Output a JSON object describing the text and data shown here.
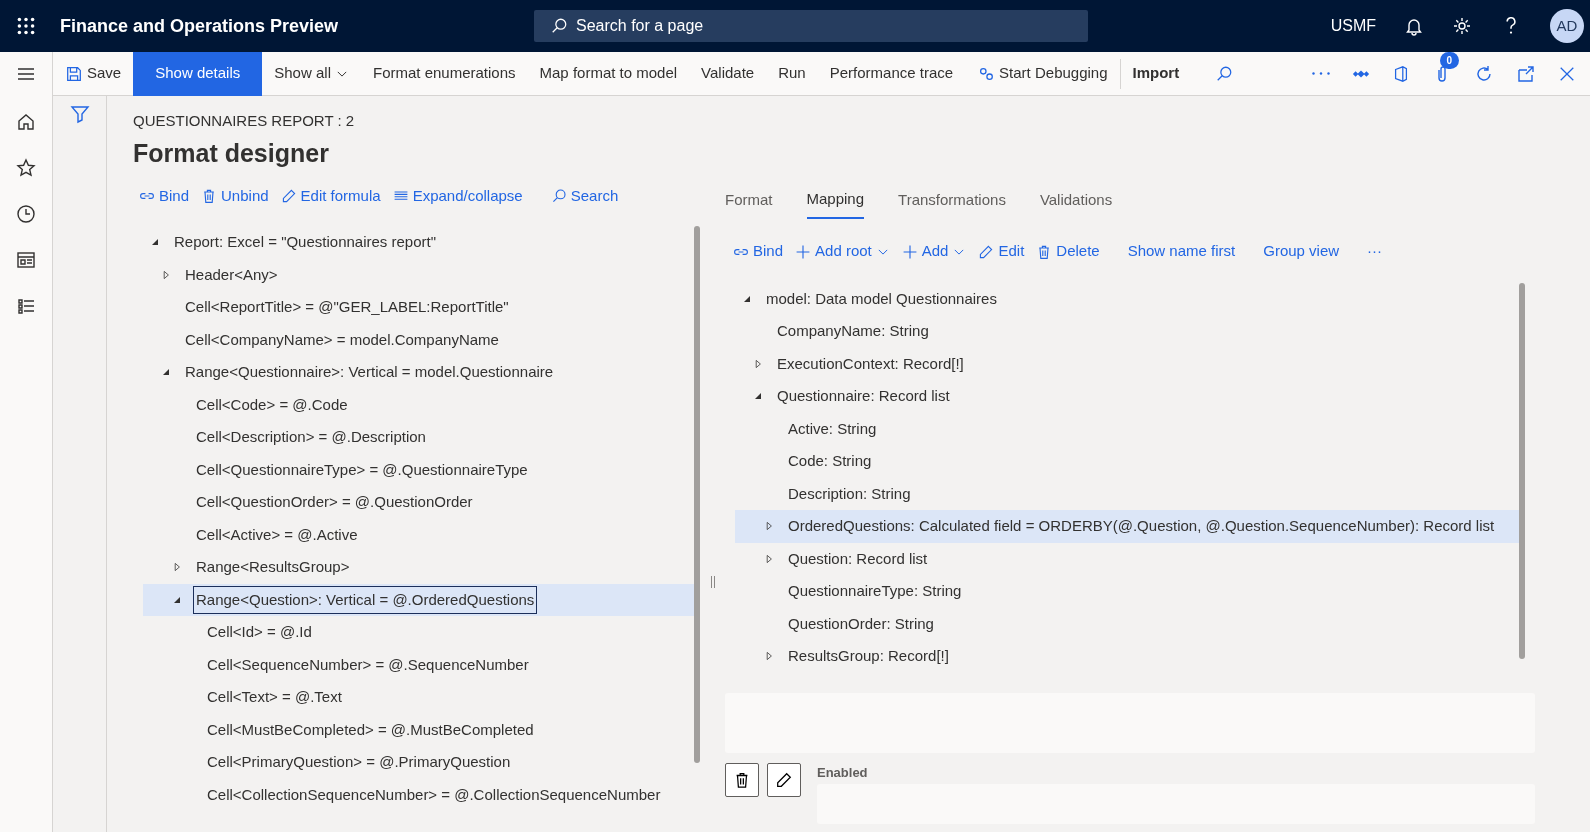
{
  "header": {
    "app_title": "Finance and Operations Preview",
    "search_placeholder": "Search for a page",
    "company": "USMF",
    "avatar": "AD"
  },
  "action_bar": {
    "items": [
      {
        "label": "Save",
        "kind": "save"
      },
      {
        "label": "Show details",
        "kind": "primary"
      },
      {
        "label": "Show all",
        "kind": "menu"
      },
      {
        "label": "Format enumerations",
        "kind": "plain"
      },
      {
        "label": "Map format to model",
        "kind": "plain"
      },
      {
        "label": "Validate",
        "kind": "plain"
      },
      {
        "label": "Run",
        "kind": "plain"
      },
      {
        "label": "Performance trace",
        "kind": "plain"
      },
      {
        "label": "Start Debugging",
        "kind": "debug"
      },
      {
        "label": "Import",
        "kind": "bold"
      }
    ],
    "attachments_count": "0"
  },
  "page": {
    "breadcrumb": "QUESTIONNAIRES REPORT : 2",
    "title": "Format designer"
  },
  "format_toolbar": [
    "Bind",
    "Unbind",
    "Edit formula",
    "Expand/collapse",
    "Search"
  ],
  "format_tree": [
    {
      "label": "Report: Excel = \"Questionnaires report\"",
      "expanded": true,
      "selected": false,
      "children": [
        {
          "label": "Header<Any>",
          "expanded": false,
          "selected": false
        },
        {
          "label": "Cell<ReportTitle> = @\"GER_LABEL:ReportTitle\"",
          "selected": false
        },
        {
          "label": "Cell<CompanyName> = model.CompanyName",
          "selected": false
        },
        {
          "label": "Range<Questionnaire>: Vertical = model.Questionnaire",
          "expanded": true,
          "selected": false,
          "children": [
            {
              "label": "Cell<Code> = @.Code",
              "selected": false
            },
            {
              "label": "Cell<Description> = @.Description",
              "selected": false
            },
            {
              "label": "Cell<QuestionnaireType> = @.QuestionnaireType",
              "selected": false
            },
            {
              "label": "Cell<QuestionOrder> = @.QuestionOrder",
              "selected": false
            },
            {
              "label": "Cell<Active> = @.Active",
              "selected": false
            },
            {
              "label": "Range<ResultsGroup>",
              "expanded": false,
              "selected": false
            },
            {
              "label": "Range<Question>: Vertical = @.OrderedQuestions",
              "expanded": true,
              "selected": true,
              "children": [
                {
                  "label": "Cell<Id> = @.Id",
                  "selected": false
                },
                {
                  "label": "Cell<SequenceNumber> = @.SequenceNumber",
                  "selected": false
                },
                {
                  "label": "Cell<Text> = @.Text",
                  "selected": false
                },
                {
                  "label": "Cell<MustBeCompleted> = @.MustBeCompleted",
                  "selected": false
                },
                {
                  "label": "Cell<PrimaryQuestion> = @.PrimaryQuestion",
                  "selected": false
                },
                {
                  "label": "Cell<CollectionSequenceNumber> = @.CollectionSequenceNumber",
                  "selected": false
                }
              ]
            }
          ]
        }
      ]
    }
  ],
  "tabs": [
    {
      "label": "Format",
      "selected": false
    },
    {
      "label": "Mapping",
      "selected": true
    },
    {
      "label": "Transformations",
      "selected": false
    },
    {
      "label": "Validations",
      "selected": false
    }
  ],
  "mapping_toolbar": [
    {
      "label": "Bind",
      "kind": "bind"
    },
    {
      "label": "Add root",
      "kind": "menu"
    },
    {
      "label": "Add",
      "kind": "add-menu"
    },
    {
      "label": "Edit",
      "kind": "edit"
    },
    {
      "label": "Delete",
      "kind": "delete"
    },
    {
      "label": "Show name first",
      "kind": "plain"
    },
    {
      "label": "Group view",
      "kind": "plain"
    },
    {
      "label": "···",
      "kind": "more"
    }
  ],
  "model_tree": [
    {
      "label": "model: Data model Questionnaires",
      "expanded": true,
      "selected": false,
      "children": [
        {
          "label": "CompanyName: String",
          "selected": false
        },
        {
          "label": "ExecutionContext: Record[!]",
          "expanded": false,
          "selected": false
        },
        {
          "label": "Questionnaire: Record list",
          "expanded": true,
          "selected": false,
          "children": [
            {
              "label": "Active: String",
              "selected": false
            },
            {
              "label": "Code: String",
              "selected": false
            },
            {
              "label": "Description: String",
              "selected": false
            },
            {
              "label": "OrderedQuestions: Calculated field = ORDERBY(@.Question, @.Question.SequenceNumber): Record list",
              "expanded": false,
              "selected": true
            },
            {
              "label": "Question: Record list",
              "expanded": false,
              "selected": false
            },
            {
              "label": "QuestionnaireType: String",
              "selected": false
            },
            {
              "label": "QuestionOrder: String",
              "selected": false
            },
            {
              "label": "ResultsGroup: Record[!]",
              "expanded": false,
              "selected": false
            }
          ]
        }
      ]
    }
  ],
  "details": {
    "enabled_label": "Enabled"
  }
}
